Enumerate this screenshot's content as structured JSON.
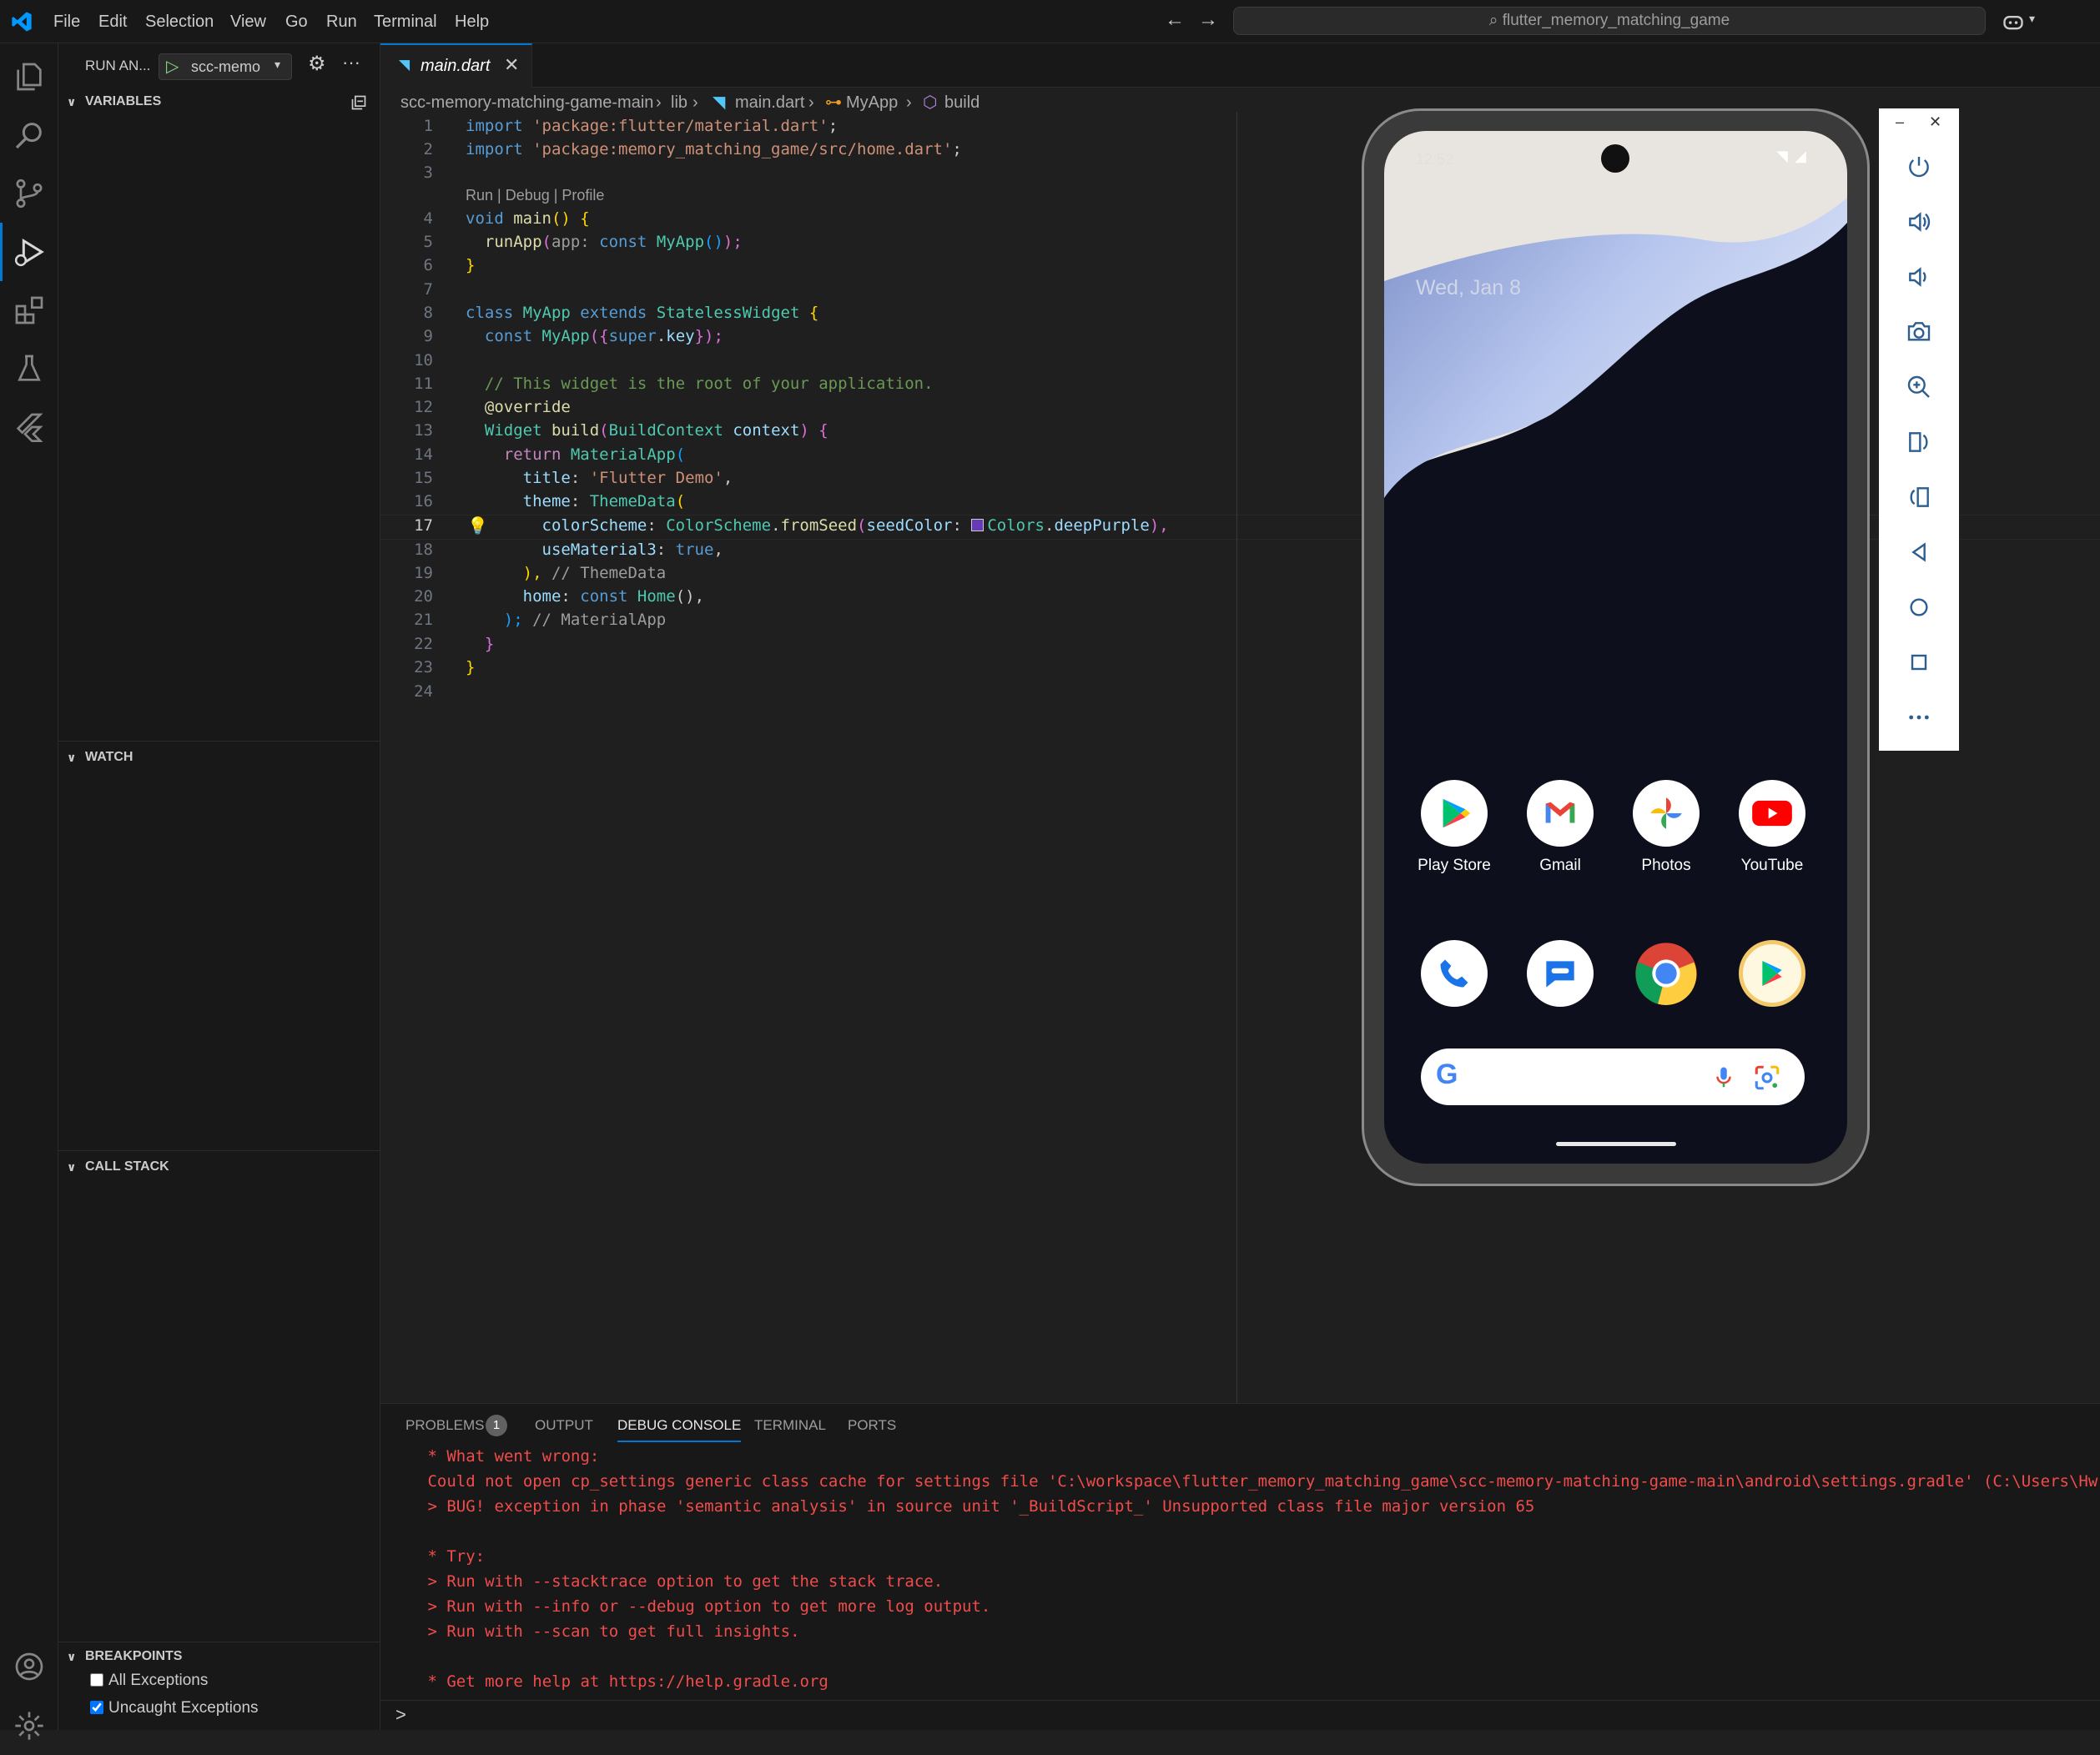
{
  "menu": {
    "file": "File",
    "edit": "Edit",
    "selection": "Selection",
    "view": "View",
    "go": "Go",
    "run": "Run",
    "terminal": "Terminal",
    "help": "Help"
  },
  "search": {
    "text": "flutter_memory_matching_game"
  },
  "sidebar": {
    "run_title": "RUN AN...",
    "config": "scc-memo",
    "variables": "VARIABLES",
    "watch": "WATCH",
    "call_stack": "CALL STACK",
    "breakpoints": "BREAKPOINTS",
    "bp_all": "All Exceptions",
    "bp_uncaught": "Uncaught Exceptions",
    "bp_all_checked": false,
    "bp_uncaught_checked": true
  },
  "editor": {
    "tab": "main.dart",
    "breadcrumb": [
      "scc-memory-matching-game-main",
      "lib",
      "main.dart",
      "MyApp",
      "build"
    ],
    "codelens": "Run | Debug | Profile",
    "lines": {
      "l1a": "import ",
      "l1b": "'package:flutter/material.dart'",
      "l1c": ";",
      "l2a": "import ",
      "l2b": "'package:memory_matching_game/src/home.dart'",
      "l2c": ";",
      "l4a": "void ",
      "l4b": "main",
      "l4c": "() {",
      "l5a": "  runApp",
      "l5b": "(",
      "l5c": "app:",
      "l5d": " const ",
      "l5e": "MyApp",
      "l5f": "()",
      ")": ")",
      "l5g": ");",
      "l6": "}",
      "l8a": "class ",
      "l8b": "MyApp ",
      "l8c": "extends ",
      "l8d": "StatelessWidget ",
      "l8e": "{",
      "l9a": "  const ",
      "l9b": "MyApp",
      "l9c": "({",
      "l9d": "super",
      "l9e": ".",
      "l9f": "key",
      "l9g": "});",
      "l11": "  // This widget is the root of your application.",
      "l12": "  @override",
      "l13a": "  Widget ",
      "l13b": "build",
      "l13c": "(",
      "l13d": "BuildContext ",
      "l13e": "context",
      "l13f": ") {",
      "l14a": "    return ",
      "l14b": "MaterialApp",
      "l14c": "(",
      "l15a": "      title",
      "l15b": ": ",
      "l15c": "'Flutter Demo'",
      "l15d": ",",
      "l16a": "      theme",
      "l16b": ": ",
      "l16c": "ThemeData",
      "l16d": "(",
      "l17a": "        colorScheme",
      "l17b": ": ",
      "l17c": "ColorScheme",
      "l17d": ".",
      "l17e": "fromSeed",
      "l17f": "(",
      "l17g": "seedColor",
      "l17h": ": ",
      "l17i": "Colors",
      "l17j": ".",
      "l17k": "deepPurple",
      "l17l": "),",
      "l18a": "        useMaterial3",
      "l18b": ": ",
      "l18c": "true",
      "l18d": ",",
      "l19a": "      ), ",
      "l19b": "// ThemeData",
      "l20a": "      home",
      "l20b": ": ",
      "l20c": "const ",
      "l20d": "Home",
      "l20e": "(),",
      "l21a": "    ); ",
      "l21b": "// MaterialApp",
      "l22": "  }",
      "l23": "}"
    },
    "line_numbers": [
      "1",
      "2",
      "3",
      "4",
      "5",
      "6",
      "7",
      "8",
      "9",
      "10",
      "11",
      "12",
      "13",
      "14",
      "15",
      "16",
      "17",
      "18",
      "19",
      "20",
      "21",
      "22",
      "23",
      "24"
    ]
  },
  "panel": {
    "tabs": [
      "PROBLEMS",
      "OUTPUT",
      "DEBUG CONSOLE",
      "TERMINAL",
      "PORTS"
    ],
    "problems_count": "1",
    "console": [
      " * What went wrong:",
      " Could not open cp_settings generic class cache for settings file 'C:\\workspace\\flutter_memory_matching_game\\scc-memory-matching-game-main\\android\\settings.gradle' (C:\\Users\\Hw",
      " > BUG! exception in phase 'semantic analysis' in source unit '_BuildScript_' Unsupported class file major version 65",
      "",
      " * Try:",
      " > Run with --stacktrace option to get the stack trace.",
      " > Run with --info or --debug option to get more log output.",
      " > Run with --scan to get full insights.",
      "",
      " * Get more help at https://help.gradle.org"
    ],
    "prompt": ">"
  },
  "phone": {
    "time": "12:52",
    "date": "Wed, Jan 8",
    "apps": [
      "Play Store",
      "Gmail",
      "Photos",
      "YouTube"
    ]
  },
  "colors": {
    "accent": "#0078d4",
    "error": "#f14c4c",
    "deepPurple": "#673ab7"
  }
}
